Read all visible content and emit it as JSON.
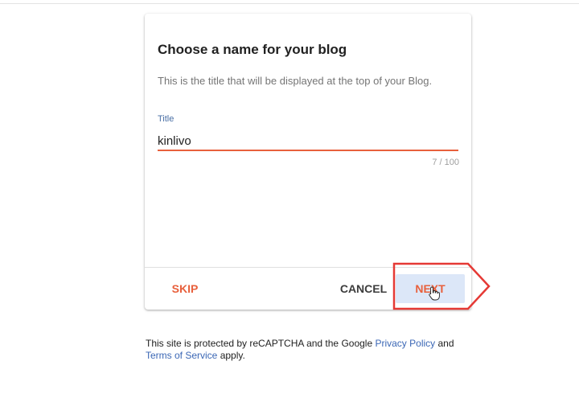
{
  "dialog": {
    "title": "Choose a name for your blog",
    "description": "This is the title that will be displayed at the top of your Blog.",
    "field": {
      "label": "Title",
      "value": "kinlivo",
      "counter": "7 / 100"
    },
    "actions": {
      "skip_label": "SKIP",
      "cancel_label": "CANCEL",
      "next_label": "NEXT"
    }
  },
  "footer": {
    "text_before": "This site is protected by reCAPTCHA and the Google ",
    "privacy_link": "Privacy Policy",
    "text_middle": " and ",
    "terms_link": "Terms of Service",
    "text_after": " apply."
  },
  "colors": {
    "accent": "#e8603c",
    "annotation": "#e53935",
    "link": "#3b67b5",
    "next_button_bg": "#dce7f8"
  },
  "icons": {
    "cursor": "hand-pointer-icon",
    "highlight": "arrow-callout-icon"
  }
}
